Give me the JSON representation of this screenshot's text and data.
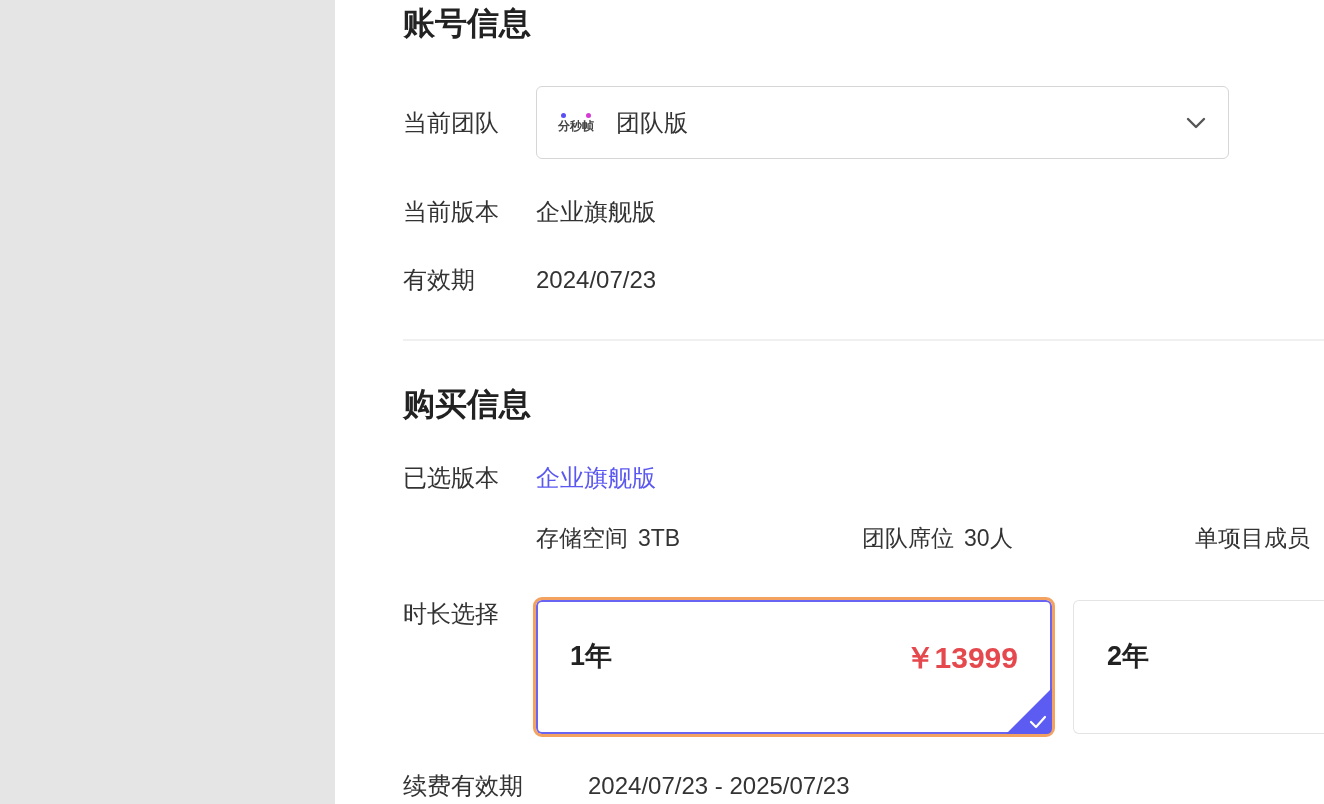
{
  "sections": [
    {
      "title": "账号信息",
      "fields": [
        {
          "kind": "select",
          "label": "当前团队",
          "logo_text": "分秒帧",
          "value": "团队版"
        },
        {
          "kind": "text",
          "label": "当前版本",
          "value": "企业旗舰版"
        },
        {
          "kind": "text",
          "label": "有效期",
          "value": "2024/07/23"
        }
      ]
    },
    {
      "title": "购买信息",
      "fields": [
        {
          "kind": "accent",
          "label": "已选版本",
          "value": "企业旗舰版"
        },
        {
          "kind": "specs",
          "specs": [
            {
              "label": "存储空间",
              "value": "3TB"
            },
            {
              "label": "团队席位",
              "value": "30人"
            },
            {
              "label": "单项目成员"
            }
          ]
        },
        {
          "kind": "duration",
          "label": "时长选择",
          "options": [
            {
              "label": "1年",
              "price": "￥13999",
              "selected": true,
              "focused": true
            },
            {
              "label": "2年",
              "selected": false,
              "focused": false
            }
          ]
        },
        {
          "kind": "period",
          "label": "续费有效期",
          "value": "2024/07/23 - 2025/07/23"
        }
      ]
    }
  ]
}
